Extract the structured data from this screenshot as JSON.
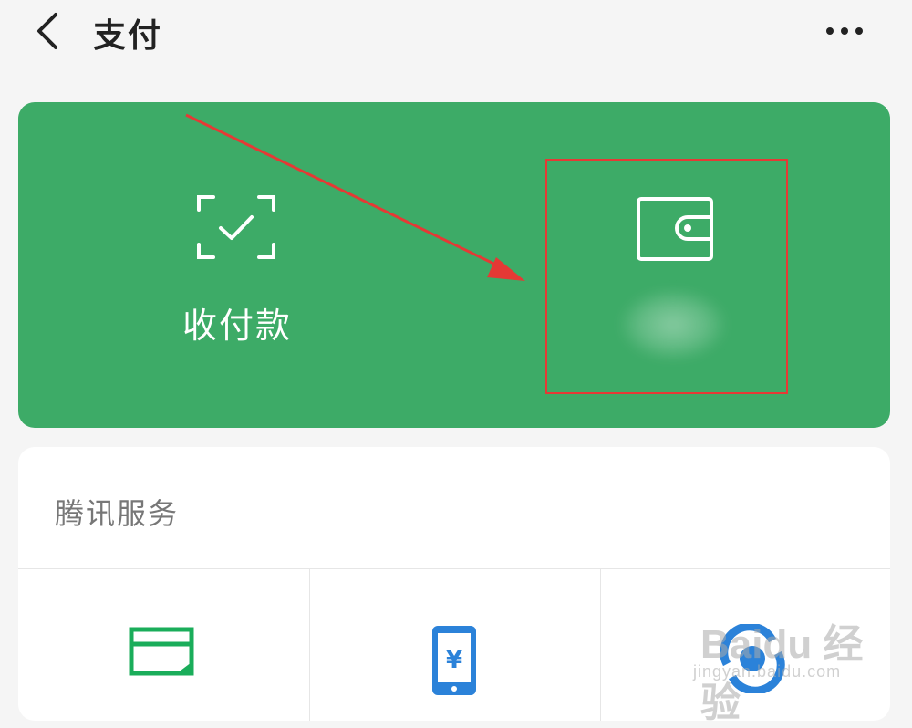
{
  "header": {
    "title": "支付",
    "back_icon": "chevron-left-icon",
    "more_icon": "more-dots-icon"
  },
  "green_card": {
    "background": "#3dab67",
    "pay_tile": {
      "label": "收付款",
      "icon": "scan-check-icon"
    },
    "wallet_tile": {
      "label": "",
      "icon": "wallet-icon",
      "highlight_color": "#e53935"
    }
  },
  "services": {
    "title": "腾讯服务",
    "items": [
      {
        "icon": "credit-card-icon",
        "color": "#1aad5a"
      },
      {
        "icon": "mobile-yuan-icon",
        "color": "#2b82d9"
      },
      {
        "icon": "refresh-yuan-icon",
        "color": "#2b82d9"
      }
    ]
  },
  "watermark": {
    "brand": "Baidu 经验",
    "site": "jingyan.baidu.com"
  }
}
